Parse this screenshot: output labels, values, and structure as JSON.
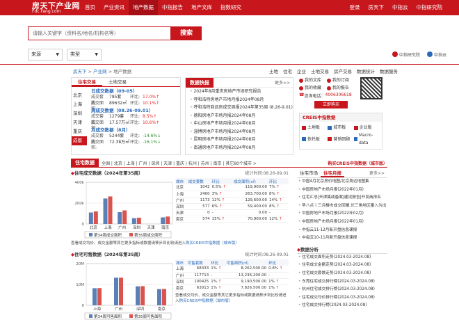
{
  "topbar": {
    "logo_main": "房天下产业网",
    "logo_sub": "Fdc.Fang.com",
    "nav": [
      {
        "label": "首页",
        "active": false
      },
      {
        "label": "产业资讯",
        "active": false
      },
      {
        "label": "地产数据",
        "active": true
      },
      {
        "label": "中指报告",
        "active": false
      },
      {
        "label": "地产文库",
        "active": false
      },
      {
        "label": "指数研究",
        "active": false
      }
    ],
    "right": [
      "登录",
      "房天下",
      "中指云",
      "中指研究院"
    ]
  },
  "search": {
    "placeholder": "请输入关键字（资料名/地名/机构名等）",
    "button": "搜索",
    "filter_source": "来源",
    "filter_type": "类型"
  },
  "brands": [
    "中指研究院",
    "中指云"
  ],
  "breadcrumb": {
    "items": [
      "房天下",
      "产业网",
      "地产数据"
    ],
    "sep": ">"
  },
  "linkbar": [
    "土地",
    "住宅",
    "企业",
    "土地交易",
    "房产交易",
    "数据统计",
    "数据服务"
  ],
  "deal_box": {
    "tabs": [
      "住宅交易",
      "土地交易"
    ],
    "cities": [
      "北京",
      "上海",
      "深圳",
      "天津",
      "重庆",
      "成都"
    ],
    "active_city": "成都",
    "day": {
      "title": "日成交数据（09-05）",
      "rows": [
        {
          "k": "成交套数:",
          "v": "785套",
          "k2": "环比:",
          "chg": "17.0%",
          "dir": "up"
        },
        {
          "k": "成交面积:",
          "v": "89632㎡",
          "k2": "环比:",
          "chg": "10.1%",
          "dir": "up"
        }
      ]
    },
    "week": {
      "title": "周成交数据（08.26-09.01）",
      "rows": [
        {
          "k": "成交套数:",
          "v": "1279套",
          "k2": "环比:",
          "chg": "8.5%",
          "dir": "up"
        },
        {
          "k": "成交面积:",
          "v": "17.57万㎡",
          "k2": "环比:",
          "chg": "10.6%",
          "dir": "up"
        }
      ]
    },
    "month": {
      "title": "月成交数据（8月）",
      "rows": [
        {
          "k": "成交套数:",
          "v": "5244套",
          "k2": "环比:",
          "chg": "-14.6%",
          "dir": "down"
        },
        {
          "k": "成交面积:",
          "v": "72.38万㎡",
          "k2": "环比:",
          "chg": "-16.1%",
          "dir": "down"
        }
      ]
    }
  },
  "news_box": {
    "title": "数据快报",
    "more": "更多>>",
    "items": [
      "2024年8月重庆房地产市场研究报告",
      "呼和浩特房地产市场月报2024年08月",
      "呼和浩特商品房成交周报2024年第35周 (8.26-9.01)",
      "德阳房地产市场月报2024年08月",
      "中山房地产市场月报2024年08月",
      "淄博房地产市场月报2024年08月",
      "昆明房地产市场月报2024年08月",
      "南通房地产市场月报2024年08月"
    ]
  },
  "tools": {
    "items": [
      "我的文库",
      "我的订阅",
      "我的收藏",
      "我的报告"
    ],
    "hotline_label": "咨询电话：",
    "hotline": "4006306618",
    "open_btn": "立即购买"
  },
  "creis": {
    "title": "CREIS中指数据",
    "items": [
      "土地板",
      "城市板",
      "企业版",
      "依托板",
      "营销回顾",
      "Macro-data"
    ]
  },
  "section": {
    "title": "住宅数据",
    "cities": "全国 | 北京 | 上海 | 广州 | 深圳 | 天津 | 重庆 | 杭州 | 苏州 | 南京 | 其它80个城市 >",
    "right": "购买CREIS中指数据（城市版）"
  },
  "panel_deal": {
    "title": "住宅成交数据（2024年第35周）",
    "period_label": "统计时间:",
    "period": "08.26-09.01",
    "headers": [
      "城市",
      "成交套数",
      "环比",
      "成交面积(㎡)",
      "环比"
    ],
    "rows": [
      [
        "北京",
        "1042",
        "0.5%",
        "up",
        "119,900.00",
        "7%",
        "up"
      ],
      [
        "上海",
        "2400",
        "3%",
        "up",
        "263,700.00",
        "8%",
        "up"
      ],
      [
        "广州",
        "1173",
        "12%",
        "up",
        "129,600.00",
        "14%",
        "up"
      ],
      [
        "深圳",
        "577",
        "6%",
        "up",
        "59,400.00",
        "8%",
        "up"
      ],
      [
        "天津",
        "0",
        "-",
        "",
        "0.00",
        "-",
        ""
      ],
      [
        "南京",
        "574",
        "15%",
        "up",
        "70,900.00",
        "12%",
        "up"
      ]
    ],
    "note": "查看成交均价、成交金额等其它更多指标或数据请移步到比较请进入",
    "note_link": "购买CREIS中指数据（城市版）"
  },
  "panel_supply": {
    "title": "住宅可售数据（2024年第35周）",
    "period_label": "统计时间:",
    "period": "08.26-09.01",
    "headers": [
      "城市",
      "可售套数",
      "环比",
      "可售面积(㎡)",
      "环比"
    ],
    "rows": [
      [
        "上海",
        "68333",
        "1%",
        "up",
        "8,262,500.00",
        "0.8%",
        "up"
      ],
      [
        "广州",
        "117713",
        "-",
        "",
        "13,236,200.00",
        "-",
        ""
      ],
      [
        "深圳",
        "100425",
        "1%",
        "up",
        "9,190,500.00",
        "1%",
        "up"
      ],
      [
        "南京",
        "63013",
        "1%",
        "up",
        "7,826,500.00",
        "1%",
        "up"
      ]
    ],
    "note": "查看成交均价、成交金额等其它更多指标或数据请移步到比较请进入",
    "note_link": "购买CREIS中指数据（城市版）"
  },
  "side": {
    "tabs": [
      "住宅市场",
      "住宅月报"
    ],
    "active": "住宅月报",
    "more": "更多>>",
    "items": [
      "中国4月北京房价地图/北京周边地图集",
      "中国房地产市场月报(2022年01月)",
      "住宅汇总|天津集成备案|建设报告|开发商排名",
      "早八点丨三月楼市成交回暖,长三角地区量入为出",
      "中国房地产市场月报(2022年02月)",
      "中国房地产市场月报(2022年01月)",
      "中指云11-12月新开盘信息课报",
      "中指云10-11月新开盘信息课报"
    ],
    "analysis_title": "数据分析",
    "analysis": [
      "住宅成交面积走势(2024.03-2024.08)",
      "住宅成交金额走势(2024.03-2024.08)",
      "住宅成交套数走势(2024.03-2024.08)",
      "东莞住宅成交排行榜(2024.03-2024.08)",
      "杭州住宅成交排行榜(2024.03-2024.08)",
      "住宅成交均价排行榜(2024.03-2024.08)",
      "住宅成交排行榜(2024.03-2024.08)"
    ]
  },
  "chart_data": [
    {
      "type": "bar",
      "categories": [
        "北京",
        "上海",
        "广州",
        "深圳",
        "天津",
        "南京"
      ],
      "series": [
        {
          "name": "第34周成交面积",
          "values": [
            110000,
            244000,
            113000,
            55000,
            0,
            63000
          ],
          "color": "#5b80b8"
        },
        {
          "name": "第35周成交面积",
          "values": [
            119900,
            263700,
            129600,
            59400,
            0,
            70900
          ],
          "color": "#d9534f"
        }
      ],
      "yticks": [
        "0",
        "200k",
        "400k"
      ],
      "ylim": [
        0,
        400000
      ]
    },
    {
      "type": "bar",
      "categories": [
        "上海",
        "广州",
        "深圳",
        "南京"
      ],
      "series": [
        {
          "name": "第34周可售面积",
          "values": [
            8200000,
            13236200,
            9100000,
            7750000
          ],
          "color": "#5b80b8"
        },
        {
          "name": "第35周可售面积",
          "values": [
            8262500,
            13236200,
            9190500,
            7826500
          ],
          "color": "#d9534f"
        }
      ],
      "yticks": [
        "0",
        "10M",
        "20M"
      ],
      "ylim": [
        0,
        20000000
      ]
    }
  ]
}
